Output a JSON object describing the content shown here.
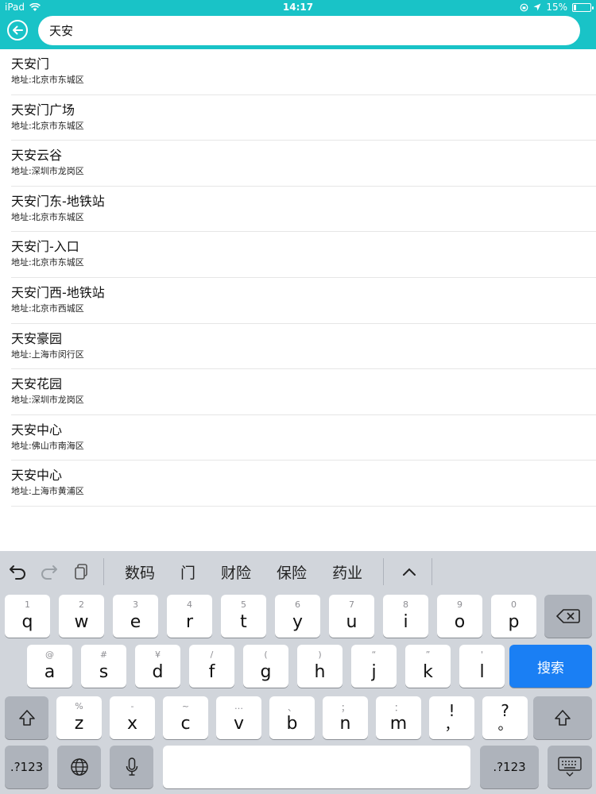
{
  "status": {
    "device": "iPad",
    "time": "14:17",
    "battery_text": "15%",
    "battery_level": 0.15
  },
  "search": {
    "value": "天安",
    "placeholder": ""
  },
  "results": [
    {
      "name": "天安门",
      "address": "地址:北京市东城区"
    },
    {
      "name": "天安门广场",
      "address": "地址:北京市东城区"
    },
    {
      "name": "天安云谷",
      "address": "地址:深圳市龙岗区"
    },
    {
      "name": "天安门东-地铁站",
      "address": "地址:北京市东城区"
    },
    {
      "name": "天安门-入口",
      "address": "地址:北京市东城区"
    },
    {
      "name": "天安门西-地铁站",
      "address": "地址:北京市西城区"
    },
    {
      "name": "天安豪园",
      "address": "地址:上海市闵行区"
    },
    {
      "name": "天安花园",
      "address": "地址:深圳市龙岗区"
    },
    {
      "name": "天安中心",
      "address": "地址:佛山市南海区"
    },
    {
      "name": "天安中心",
      "address": "地址:上海市黄浦区"
    }
  ],
  "keyboard": {
    "suggestions": [
      "数码",
      "门",
      "财险",
      "保险",
      "药业"
    ],
    "row1": [
      [
        "q",
        "1"
      ],
      [
        "w",
        "2"
      ],
      [
        "e",
        "3"
      ],
      [
        "r",
        "4"
      ],
      [
        "t",
        "5"
      ],
      [
        "y",
        "6"
      ],
      [
        "u",
        "7"
      ],
      [
        "i",
        "8"
      ],
      [
        "o",
        "9"
      ],
      [
        "p",
        "0"
      ]
    ],
    "row2": [
      [
        "a",
        "@"
      ],
      [
        "s",
        "#"
      ],
      [
        "d",
        "¥"
      ],
      [
        "f",
        "/"
      ],
      [
        "g",
        "("
      ],
      [
        "h",
        ")"
      ],
      [
        "j",
        "“"
      ],
      [
        "k",
        "”"
      ],
      [
        "l",
        "'"
      ]
    ],
    "row3": [
      [
        "z",
        "%"
      ],
      [
        "x",
        "-"
      ],
      [
        "c",
        "~"
      ],
      [
        "v",
        "…"
      ],
      [
        "b",
        "、"
      ],
      [
        "n",
        "；"
      ],
      [
        "m",
        "："
      ],
      [
        "!",
        ""
      ],
      [
        "?",
        ""
      ]
    ],
    "row3_sub": {
      "excl": "，",
      "quest": "。"
    },
    "search_key": "搜索",
    "numbers_key": ".?123"
  },
  "colors": {
    "header": "#19c3c7",
    "search_key": "#1a7ff4"
  }
}
